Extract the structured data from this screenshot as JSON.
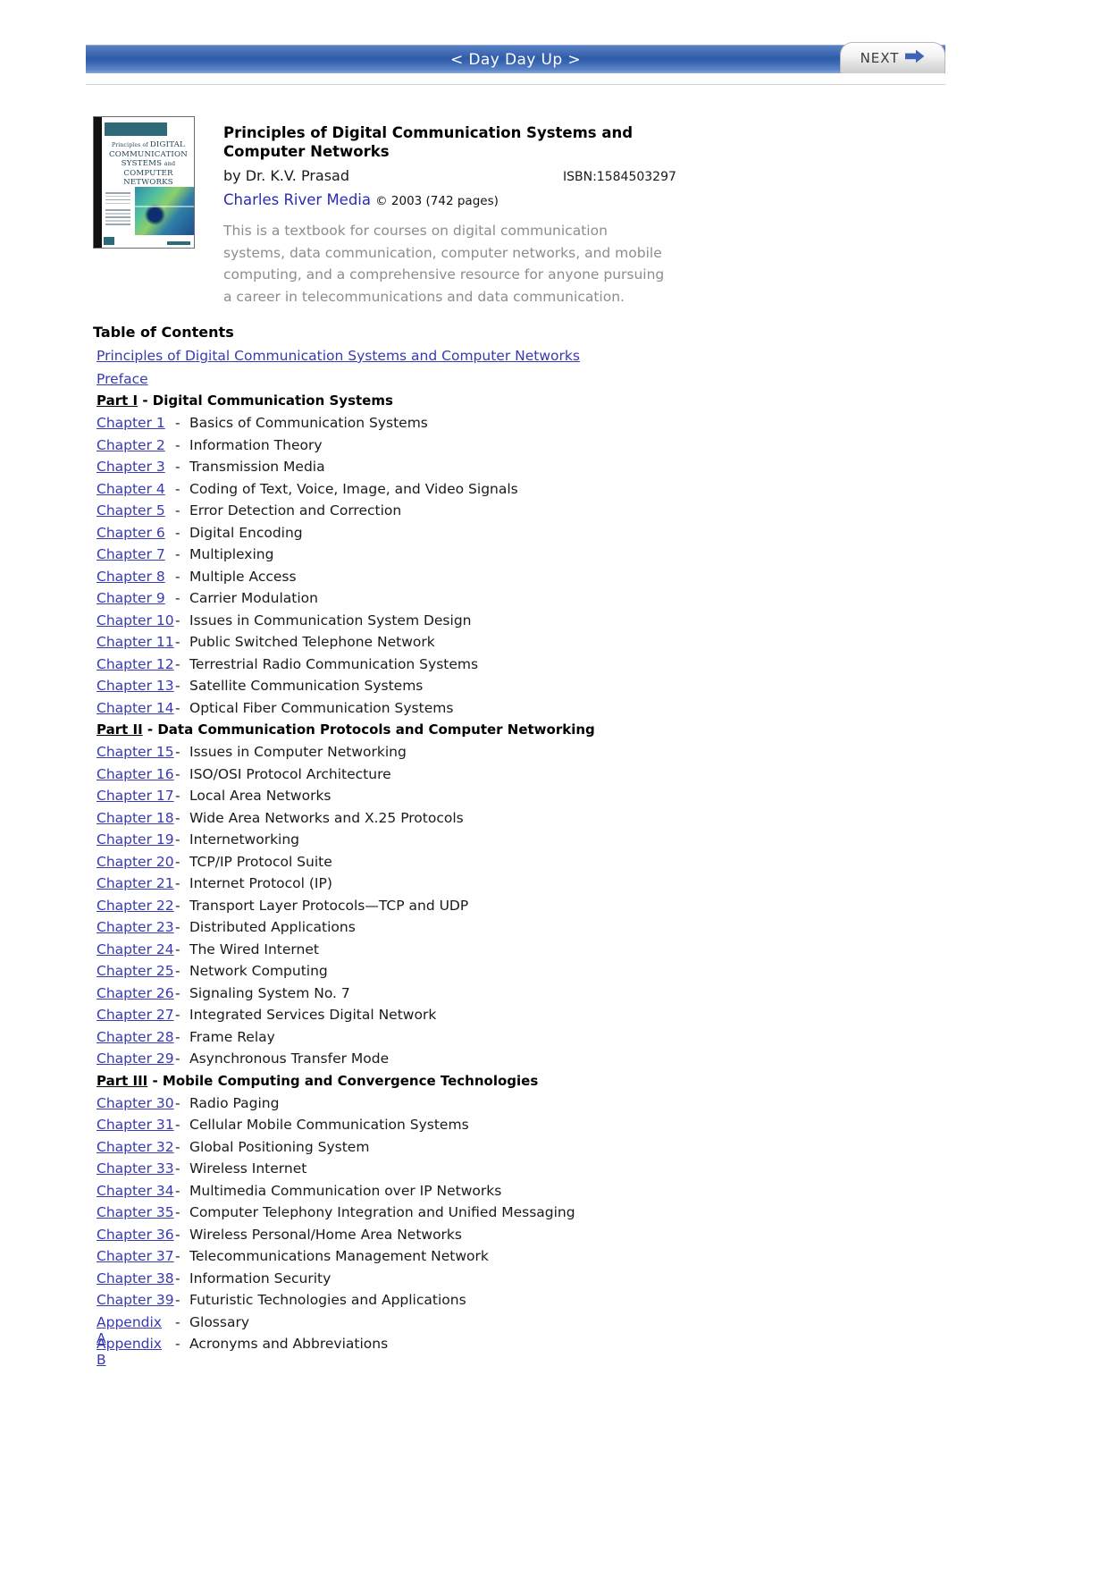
{
  "nav": {
    "title": "< Day Day Up >",
    "next_label": "NEXT",
    "next_icon": "arrow-right-icon"
  },
  "book": {
    "title": "Principles of Digital Communication Systems and Computer Networks",
    "author": "by Dr. K.V. Prasad",
    "isbn": "ISBN:1584503297",
    "publisher": "Charles River Media",
    "copyright": "© 2003 (742 pages)",
    "description": "This is a textbook for courses on digital communication systems, data communication, computer networks, and mobile computing, and a comprehensive resource for anyone pursuing a career in telecommunications and data communication.",
    "cover_alt": "Principles of DIGITAL COMMUNICATION SYSTEMS and COMPUTER NETWORKS"
  },
  "toc": {
    "heading": "Table of Contents",
    "front": [
      {
        "label": "Principles of Digital Communication Systems and Computer Networks"
      },
      {
        "label": "Preface"
      }
    ],
    "entries": [
      {
        "type": "part",
        "label": "Part I",
        "title": " - Digital Communication Systems"
      },
      {
        "type": "chapter",
        "num": "Chapter 1",
        "dash": "-",
        "title": "Basics of Communication Systems"
      },
      {
        "type": "chapter",
        "num": "Chapter 2",
        "dash": "-",
        "title": "Information Theory"
      },
      {
        "type": "chapter",
        "num": "Chapter 3",
        "dash": "-",
        "title": "Transmission Media"
      },
      {
        "type": "chapter",
        "num": "Chapter 4",
        "dash": "-",
        "title": "Coding of Text, Voice, Image, and Video Signals"
      },
      {
        "type": "chapter",
        "num": "Chapter 5",
        "dash": "-",
        "title": "Error Detection and Correction"
      },
      {
        "type": "chapter",
        "num": "Chapter 6",
        "dash": "-",
        "title": "Digital Encoding"
      },
      {
        "type": "chapter",
        "num": "Chapter 7",
        "dash": "-",
        "title": "Multiplexing"
      },
      {
        "type": "chapter",
        "num": "Chapter 8",
        "dash": "-",
        "title": "Multiple Access"
      },
      {
        "type": "chapter",
        "num": "Chapter 9",
        "dash": "-",
        "title": "Carrier Modulation"
      },
      {
        "type": "chapter",
        "num": "Chapter 10",
        "dash": "-",
        "title": "Issues in Communication System Design"
      },
      {
        "type": "chapter",
        "num": "Chapter 11",
        "dash": "-",
        "title": "Public Switched Telephone Network"
      },
      {
        "type": "chapter",
        "num": "Chapter 12",
        "dash": "-",
        "title": "Terrestrial Radio Communication Systems"
      },
      {
        "type": "chapter",
        "num": "Chapter 13",
        "dash": "-",
        "title": "Satellite Communication Systems"
      },
      {
        "type": "chapter",
        "num": "Chapter 14",
        "dash": "-",
        "title": "Optical Fiber Communication Systems"
      },
      {
        "type": "part",
        "label": "Part II",
        "title": " - Data Communication Protocols and Computer Networking"
      },
      {
        "type": "chapter",
        "num": "Chapter 15",
        "dash": "-",
        "title": "Issues in Computer Networking"
      },
      {
        "type": "chapter",
        "num": "Chapter 16",
        "dash": "-",
        "title": "ISO/OSI Protocol Architecture"
      },
      {
        "type": "chapter",
        "num": "Chapter 17",
        "dash": "-",
        "title": "Local Area Networks"
      },
      {
        "type": "chapter",
        "num": "Chapter 18",
        "dash": "-",
        "title": "Wide Area Networks and X.25 Protocols"
      },
      {
        "type": "chapter",
        "num": "Chapter 19",
        "dash": "-",
        "title": "Internetworking"
      },
      {
        "type": "chapter",
        "num": "Chapter 20",
        "dash": "-",
        "title": "TCP/IP Protocol Suite"
      },
      {
        "type": "chapter",
        "num": "Chapter 21",
        "dash": "-",
        "title": "Internet Protocol (IP)"
      },
      {
        "type": "chapter",
        "num": "Chapter 22",
        "dash": "-",
        "title": "Transport Layer Protocols—TCP and UDP"
      },
      {
        "type": "chapter",
        "num": "Chapter 23",
        "dash": "-",
        "title": "Distributed Applications"
      },
      {
        "type": "chapter",
        "num": "Chapter 24",
        "dash": "-",
        "title": "The Wired Internet"
      },
      {
        "type": "chapter",
        "num": "Chapter 25",
        "dash": "-",
        "title": "Network Computing"
      },
      {
        "type": "chapter",
        "num": "Chapter 26",
        "dash": "-",
        "title": "Signaling System No. 7"
      },
      {
        "type": "chapter",
        "num": "Chapter 27",
        "dash": "-",
        "title": "Integrated Services Digital Network"
      },
      {
        "type": "chapter",
        "num": "Chapter 28",
        "dash": "-",
        "title": "Frame Relay"
      },
      {
        "type": "chapter",
        "num": "Chapter 29",
        "dash": "-",
        "title": "Asynchronous Transfer Mode"
      },
      {
        "type": "part",
        "label": "Part III",
        "title": " - Mobile Computing and Convergence Technologies"
      },
      {
        "type": "chapter",
        "num": "Chapter 30",
        "dash": "-",
        "title": "Radio Paging"
      },
      {
        "type": "chapter",
        "num": "Chapter 31",
        "dash": "-",
        "title": "Cellular Mobile Communication Systems"
      },
      {
        "type": "chapter",
        "num": "Chapter 32",
        "dash": "-",
        "title": "Global Positioning System"
      },
      {
        "type": "chapter",
        "num": "Chapter 33",
        "dash": "-",
        "title": "Wireless Internet"
      },
      {
        "type": "chapter",
        "num": "Chapter 34",
        "dash": "-",
        "title": "Multimedia Communication over IP Networks"
      },
      {
        "type": "chapter",
        "num": "Chapter 35",
        "dash": "-",
        "title": "Computer Telephony Integration and Unified Messaging"
      },
      {
        "type": "chapter",
        "num": "Chapter 36",
        "dash": "-",
        "title": "Wireless Personal/Home Area Networks"
      },
      {
        "type": "chapter",
        "num": "Chapter 37",
        "dash": "-",
        "title": "Telecommunications Management Network"
      },
      {
        "type": "chapter",
        "num": "Chapter 38",
        "dash": "-",
        "title": "Information Security"
      },
      {
        "type": "chapter",
        "num": "Chapter 39",
        "dash": "-",
        "title": "Futuristic Technologies and Applications"
      },
      {
        "type": "chapter",
        "num": "Appendix A",
        "dash": "-",
        "title": "Glossary"
      },
      {
        "type": "chapter",
        "num": "Appendix B",
        "dash": "-",
        "title": "Acronyms and Abbreviations"
      }
    ]
  },
  "colors": {
    "nav_blue": "#2f5ba8",
    "link_blue": "#3939b4",
    "publisher_blue": "#2b2bb3",
    "description_gray": "#8d8d8d"
  }
}
